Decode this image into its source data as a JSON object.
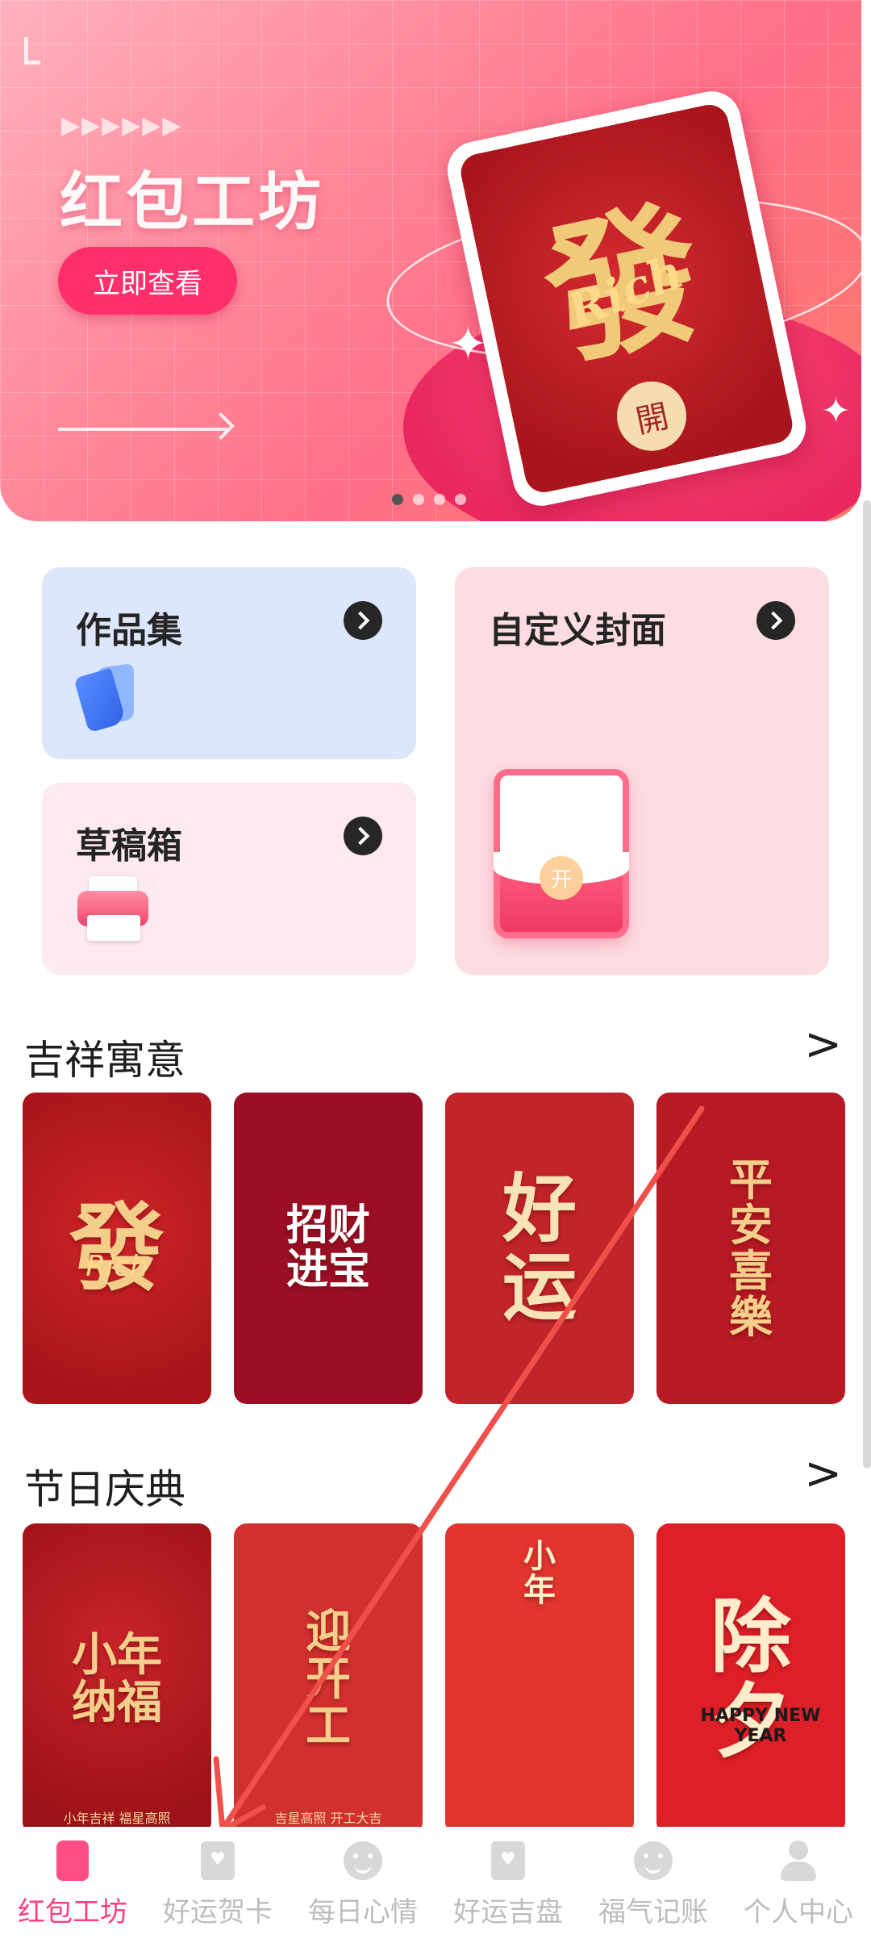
{
  "banner": {
    "title": "红包工坊",
    "button_label": "立即查看",
    "card_glyph": "發",
    "card_script": "Rich",
    "card_badge": "開",
    "arrows": "▶▶▶▶▶▶"
  },
  "quick": {
    "works_label": "作品集",
    "drafts_label": "草稿箱",
    "custom_label": "自定义封面",
    "packet_button": "开"
  },
  "sections": {
    "auspicious": {
      "title": "吉祥寓意",
      "more": ">",
      "tiles": [
        {
          "text": "發",
          "sub": "Rich"
        },
        {
          "text": "招财进宝"
        },
        {
          "text": "好运"
        },
        {
          "text": "平安喜樂"
        }
      ]
    },
    "festival": {
      "title": "节日庆典",
      "more": ">",
      "tiles": [
        {
          "text": "小年纳福",
          "sub": "小年吉祥 福星高照"
        },
        {
          "text": "迎开工",
          "sub": "吉星高照 开工大吉"
        },
        {
          "text": "小年"
        },
        {
          "text": "除夕",
          "sub": "HAPPY NEW YEAR"
        }
      ]
    }
  },
  "nav": {
    "items": [
      {
        "label": "红包工坊",
        "icon": "red-packet-icon",
        "active": true
      },
      {
        "label": "好运贺卡",
        "icon": "greeting-card-icon"
      },
      {
        "label": "每日心情",
        "icon": "smiley-icon"
      },
      {
        "label": "好运吉盘",
        "icon": "fortune-card-icon"
      },
      {
        "label": "福气记账",
        "icon": "smiley-icon"
      },
      {
        "label": "个人中心",
        "icon": "user-icon"
      }
    ]
  },
  "colors": {
    "accent": "#ff3f79",
    "banner_button": "#ff2f6c",
    "tile_red": "#b81a24",
    "annotation_arrow": "#f0504a"
  }
}
